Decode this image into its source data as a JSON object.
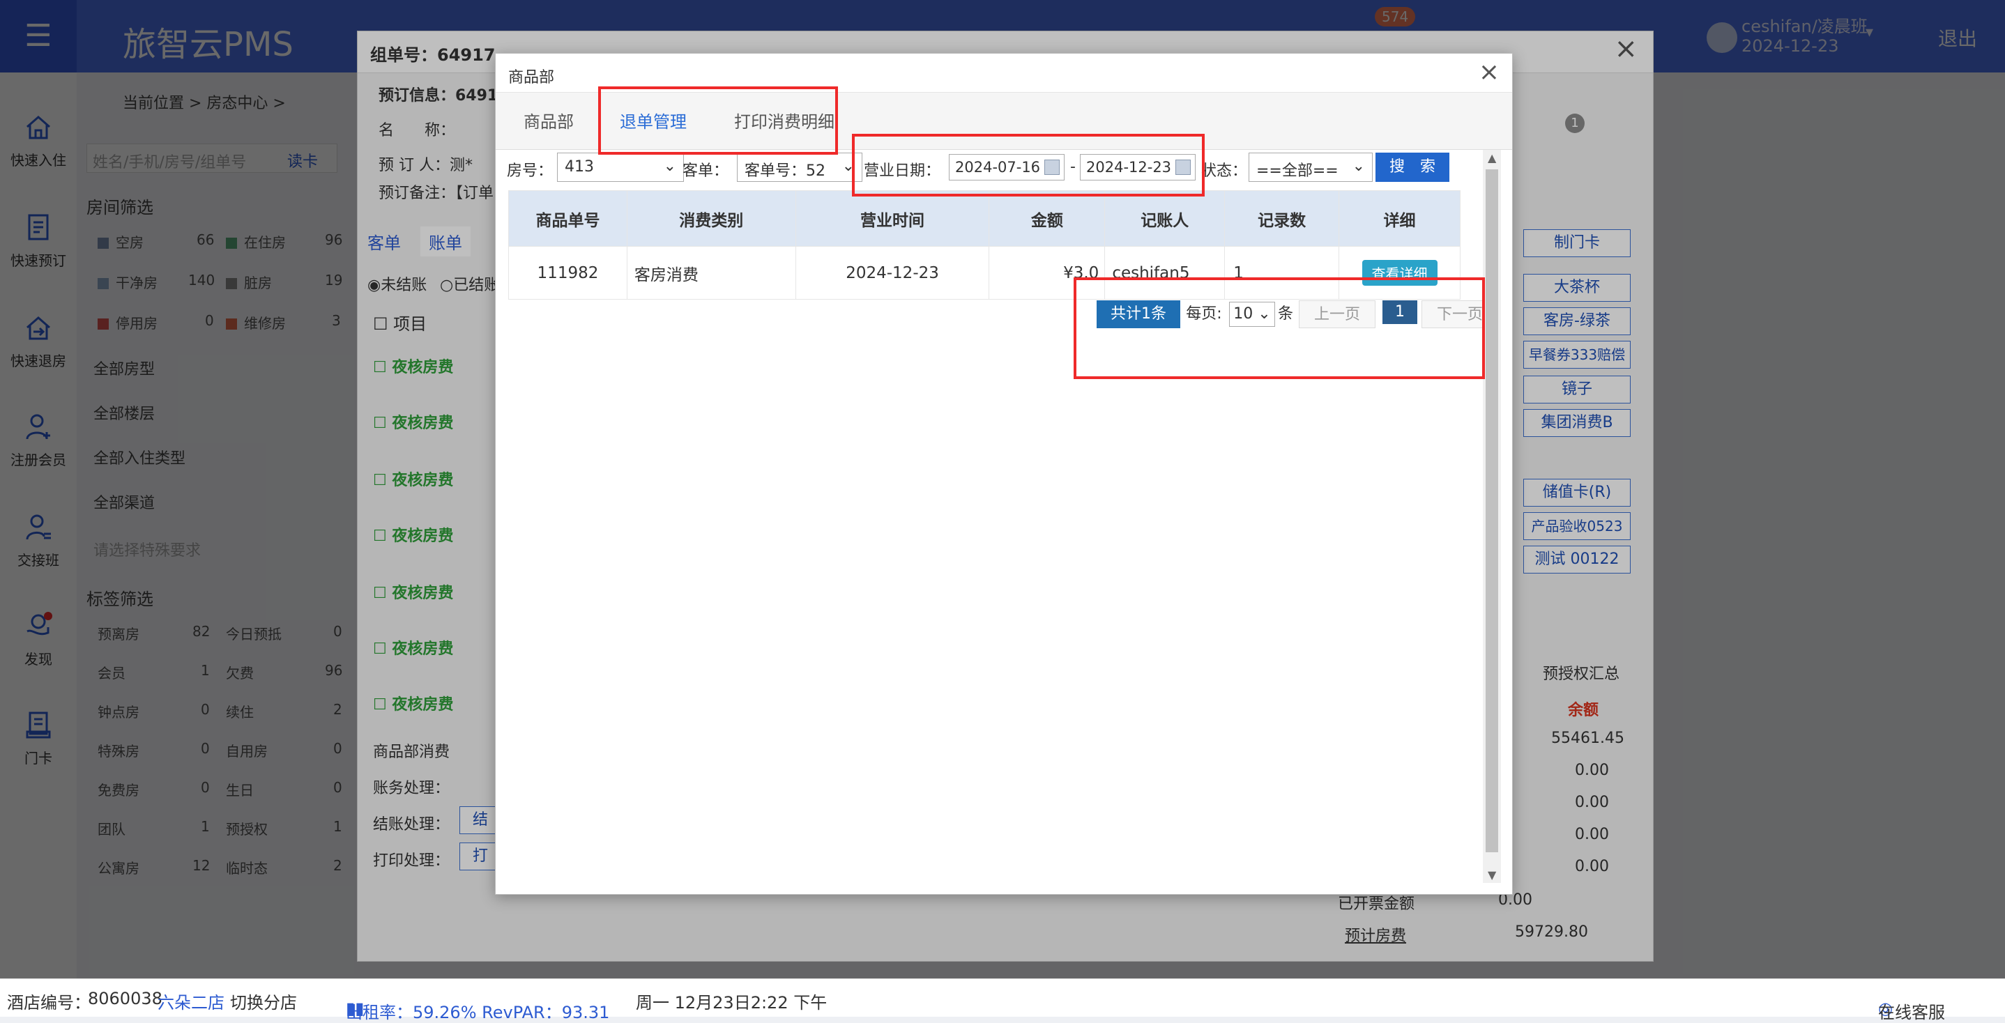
{
  "app": {
    "title": "旅智云PMS",
    "user_name": "ceshifan/凌晨班",
    "user_date": "2024-12-23",
    "logout": "退出",
    "notif_count": "574"
  },
  "sidebar": {
    "items": [
      {
        "label": "快速入住",
        "icon": "home-icon"
      },
      {
        "label": "快速预订",
        "icon": "document-icon"
      },
      {
        "label": "快速退房",
        "icon": "checkout-icon"
      },
      {
        "label": "注册会员",
        "icon": "user-add-icon"
      },
      {
        "label": "交接班",
        "icon": "shift-icon"
      },
      {
        "label": "发现",
        "icon": "discover-icon"
      },
      {
        "label": "门卡",
        "icon": "card-icon"
      }
    ]
  },
  "background": {
    "breadcrumb": "当前位置 > 房态中心 >",
    "search_placeholder": "姓名/手机/房号/组单号",
    "read_card": "读卡",
    "room_filter_title": "房间筛选",
    "room_status": [
      {
        "label": "空房",
        "count": "66",
        "color": "#7a8fb0"
      },
      {
        "label": "在住房",
        "count": "96",
        "color": "#5aa87a"
      },
      {
        "label": "干净房",
        "count": "140",
        "color": "#8fa8c8"
      },
      {
        "label": "脏房",
        "count": "19",
        "color": "#8a8a8a"
      },
      {
        "label": "停用房",
        "count": "0",
        "color": "#d9534f"
      },
      {
        "label": "维修房",
        "count": "3",
        "color": "#e06a4a"
      }
    ],
    "dropdowns": [
      "全部房型",
      "全部楼层",
      "全部入住类型",
      "全部渠道"
    ],
    "special_req_placeholder": "请选择特殊要求",
    "tag_filter_title": "标签筛选",
    "tags": [
      {
        "label": "预离房",
        "count": "82"
      },
      {
        "label": "今日预抵",
        "count": "0"
      },
      {
        "label": "会员",
        "count": "1"
      },
      {
        "label": "欠费",
        "count": "96"
      },
      {
        "label": "钟点房",
        "count": "0"
      },
      {
        "label": "续住",
        "count": "2"
      },
      {
        "label": "特殊房",
        "count": "0"
      },
      {
        "label": "自用房",
        "count": "0"
      },
      {
        "label": "免费房",
        "count": "0"
      },
      {
        "label": "生日",
        "count": "0"
      },
      {
        "label": "团队",
        "count": "1"
      },
      {
        "label": "预授权",
        "count": "1"
      },
      {
        "label": "公寓房",
        "count": "12"
      },
      {
        "label": "临时态",
        "count": "2"
      }
    ]
  },
  "order": {
    "group_no": "组单号：64917",
    "booking_info": "预订信息：6491",
    "name_label": "名　　称：",
    "booker_label": "预 订 人：测*",
    "remark_label": "预订备注：【订单",
    "tab_guest": "客单",
    "tab_bill": "账单",
    "radio_unsettled": "未结账",
    "radio_settled": "已结账",
    "col_item": "项目",
    "rows": [
      "夜核房费",
      "夜核房费",
      "夜核房费",
      "夜核房费",
      "夜核房费",
      "夜核房费",
      "夜核房费"
    ],
    "goods_consume": "商品部消费",
    "acct_label": "账务处理：",
    "settle_label": "结账处理：",
    "settle_btn": "结",
    "print_label": "打印处理：",
    "print_btn": "打",
    "right_badge": "1",
    "right_buttons": [
      "制门卡",
      "大茶杯",
      "客房-绿茶",
      "早餐券333赔偿",
      "镜子",
      "集团消费B",
      "储值卡(R)",
      "产品验收0523",
      "测试 00122"
    ],
    "preauth_summary": "预授权汇总",
    "summary_head": "余额",
    "summary_values": [
      "55461.45",
      "0.00",
      "0.00",
      "0.00",
      "0.00"
    ],
    "invoiced_label": "已开票金额",
    "invoiced_value": "0.00",
    "expected_label": "预计房费",
    "expected_value": "59729.80"
  },
  "goods": {
    "title": "商品部",
    "tabs": [
      "商品部",
      "退单管理",
      "打印消费明细"
    ],
    "active_tab": 1,
    "room_label": "房号：",
    "room_value": "413",
    "guest_label": "客单：",
    "guest_value": "客单号：52",
    "date_label": "营业日期：",
    "date_from": "2024-07-16",
    "date_to": "2024-12-23",
    "date_sep": "-",
    "status_label": "状态：",
    "status_value": "==全部==",
    "search_btn": "搜　索",
    "columns": [
      "商品单号",
      "消费类别",
      "营业时间",
      "金额",
      "记账人",
      "记录数",
      "详细"
    ],
    "rows": [
      {
        "no": "111982",
        "category": "客房消费",
        "time": "2024-12-23",
        "amount": "¥3.0",
        "clerk": "ceshifan5",
        "count": "1",
        "detail": "查看详细"
      }
    ],
    "pager": {
      "total": "共计1条",
      "per_page_label": "每页:",
      "per_page": "10",
      "unit": "条",
      "prev": "上一页",
      "page": "1",
      "next": "下一页"
    }
  },
  "statusbar": {
    "hotel_label": "酒店编号：",
    "hotel_no": "8060038",
    "branch": "六朵二店",
    "switch": "切换分店",
    "occupancy": "出租率：59.26% RevPAR：93.31",
    "datetime": "周一 12月23日2:22 下午",
    "service": "在线客服"
  }
}
